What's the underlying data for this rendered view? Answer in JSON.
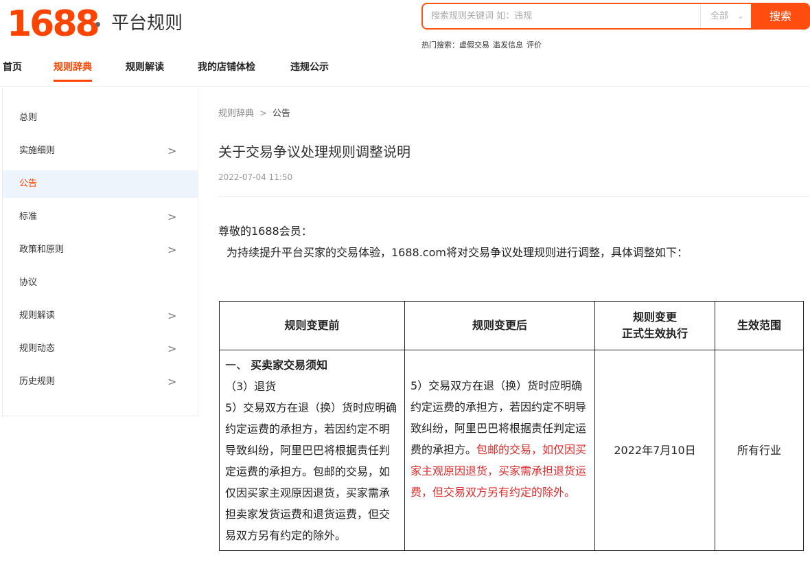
{
  "header": {
    "logo": "1688",
    "site_title": "平台规则",
    "search": {
      "placeholder": "搜索规则关键词 如：违规",
      "scope": "全部",
      "button": "搜索",
      "hot_label": "热门搜索：",
      "hot_terms": [
        "虚假交易",
        "滥发信息",
        "评价"
      ]
    }
  },
  "nav": {
    "items": [
      "首页",
      "规则辞典",
      "规则解读",
      "我的店铺体检",
      "违规公示"
    ],
    "active": "规则辞典"
  },
  "sidebar": {
    "items": [
      {
        "label": "总则",
        "arrow": ""
      },
      {
        "label": "实施细则",
        "arrow": ">"
      },
      {
        "label": "公告",
        "arrow": ""
      },
      {
        "label": "标准",
        "arrow": ">"
      },
      {
        "label": "政策和原则",
        "arrow": ">"
      },
      {
        "label": "协议",
        "arrow": ""
      },
      {
        "label": "规则解读",
        "arrow": ">"
      },
      {
        "label": "规则动态",
        "arrow": ">"
      },
      {
        "label": "历史规则",
        "arrow": ">"
      }
    ],
    "active": "公告"
  },
  "breadcrumb": {
    "root": "规则辞典",
    "sep": ">",
    "current": "公告"
  },
  "article": {
    "title": "关于交易争议处理规则调整说明",
    "date": "2022-07-04 11:50",
    "greeting": "尊敬的1688会员：",
    "intro": "为持续提升平台买家的交易体验，1688.com将对交易争议处理规则进行调整，具体调整如下："
  },
  "table": {
    "headers": {
      "before": "规则变更前",
      "after": "规则变更后",
      "effective_line1": "规则变更",
      "effective_line2": "正式生效执行",
      "scope": "生效范围"
    },
    "before": {
      "section_num": "一、",
      "section_title": "买卖家交易须知",
      "sub": "（3）退货",
      "body": "5）交易双方在退（换）货时应明确约定运费的承担方，若因约定不明导致纠纷，阿里巴巴将根据责任判定运费的承担方。包邮的交易，如仅因买家主观原因退货，买家需承担卖家发货运费和退货运费，但交易双方另有约定的除外。"
    },
    "after": {
      "body": "5）交易双方在退（换）货时应明确约定运费的承担方，若因约定不明导致纠纷，阿里巴巴将根据责任判定运费的承担方。",
      "highlight": "包邮的交易，如仅因买家主观原因退货，买家需承担退货运费，但交易双方另有约定的除外。"
    },
    "effective_date": "2022年7月10日",
    "scope": "所有行业"
  },
  "colors": {
    "brand": "#ff4400",
    "highlight": "#e02b2b",
    "active_bg": "#eef4fb"
  }
}
